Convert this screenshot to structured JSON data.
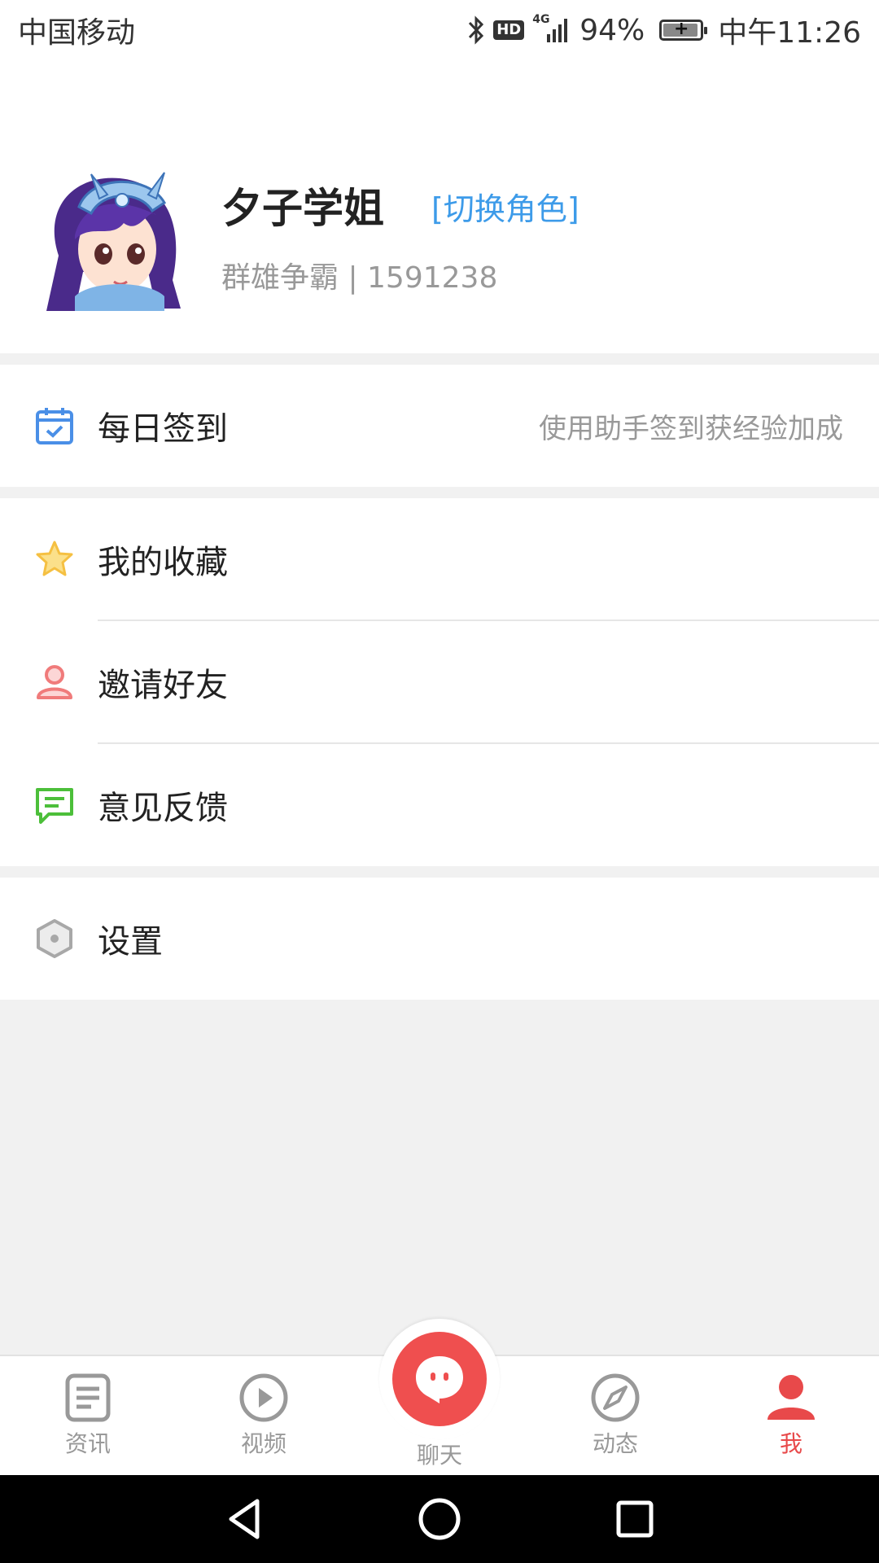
{
  "status_bar": {
    "carrier": "中国移动",
    "hd": "HD",
    "network": "4G",
    "battery_percent": "94%",
    "battery_level": 0.94,
    "time": "中午11:26"
  },
  "profile": {
    "name": "夕子学姐",
    "switch_role": "[切换角色]",
    "subtitle": "群雄争霸 | 1591238"
  },
  "menu": {
    "checkin": {
      "label": "每日签到",
      "hint": "使用助手签到获经验加成",
      "icon": "calendar-check-icon",
      "color": "#4a8fe7"
    },
    "favorites": {
      "label": "我的收藏",
      "icon": "star-icon",
      "color": "#f5c042"
    },
    "invite": {
      "label": "邀请好友",
      "icon": "person-icon",
      "color": "#f07b7b"
    },
    "feedback": {
      "label": "意见反馈",
      "icon": "message-icon",
      "color": "#4cbf3a"
    },
    "settings": {
      "label": "设置",
      "icon": "hexagon-gear-icon",
      "color": "#9a9a9a"
    }
  },
  "bottom_nav": {
    "items": [
      {
        "label": "资讯",
        "icon": "news-icon"
      },
      {
        "label": "视频",
        "icon": "play-icon"
      },
      {
        "label": "聊天",
        "icon": "chat-icon"
      },
      {
        "label": "动态",
        "icon": "compass-icon"
      },
      {
        "label": "我",
        "icon": "user-icon"
      }
    ],
    "active_index": 4,
    "accent_color": "#e8494a"
  }
}
